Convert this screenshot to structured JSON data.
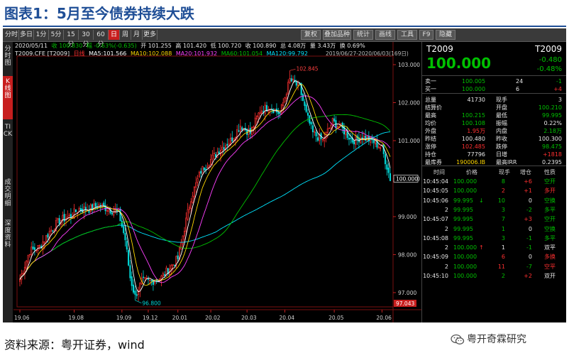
{
  "figure": {
    "title": "图表1：5月至今债券持续大跌",
    "source": "资料来源：粤开证券，wind",
    "watermark": "粤开奇霖研究"
  },
  "toolbar": {
    "left": [
      "分时",
      "多日",
      "1分",
      "5分",
      "15分",
      "30分",
      "60分",
      "日",
      "周",
      "月",
      "更多"
    ],
    "active": "日",
    "right": [
      "复权",
      "叠加品种",
      "统计",
      "画线",
      "工具",
      "F9",
      "隐藏"
    ]
  },
  "side_tabs": [
    "分时图",
    "K线图",
    "TICK",
    "成交明细",
    "深度资料"
  ],
  "side_tab_active": "K线图",
  "info": {
    "date": "2020/05/11",
    "close_lbl": "收 100.830",
    "chg_lbl": "幅 -0.63%(-0.635)",
    "open_lbl": "开 101.255",
    "high_lbl": "高 101.420",
    "low_lbl": "低 100.720",
    "lastclose_lbl": "收 100.890",
    "amount_lbl": "总 4.08万",
    "vol_lbl": "量 3.43万",
    "turn_lbl": "换 0.69%",
    "code_lbl": "T2009.CFE [T2009]",
    "period_lbl": "日线",
    "ma5": "MA5:101.566",
    "ma10": "MA10:102.088",
    "ma20": "MA20:101.932",
    "ma60": "MA60:101.054",
    "ma120": "MA120:99.792",
    "range": "2019/06/27-2020/06/03(169日)"
  },
  "chart_data": {
    "type": "candlestick",
    "title": "",
    "y_ticks": [
      "103.000",
      "102.000",
      "101.000",
      "100.000",
      "99.000",
      "98.000",
      "97.000"
    ],
    "ylim": [
      96.7,
      103.15
    ],
    "x_ticks": [
      "19.06",
      "19.08",
      "19.09",
      "19.12",
      "20.01",
      "20.02",
      "20.03",
      "20.04",
      "20.05",
      "20.06"
    ],
    "x_tick_index": [
      0,
      33,
      62,
      78,
      96,
      116,
      138,
      161,
      191,
      220
    ],
    "n": 226,
    "annotations": {
      "high": "102.845",
      "low": "96.800"
    },
    "current_price": "100.000",
    "bottom_price": "97.043",
    "ma_colors": {
      "MA5": "#ffffff",
      "MA10": "#ffd700",
      "MA20": "#ff40ff",
      "MA60": "#00c000",
      "MA120": "#00e5ff"
    },
    "anchors": [
      [
        0,
        97.35
      ],
      [
        6,
        98.1
      ],
      [
        12,
        98.2
      ],
      [
        18,
        98.6
      ],
      [
        24,
        98.9
      ],
      [
        30,
        99.0
      ],
      [
        36,
        99.2
      ],
      [
        42,
        99.2
      ],
      [
        48,
        99.3
      ],
      [
        54,
        99.2
      ],
      [
        60,
        99.1
      ],
      [
        64,
        98.4
      ],
      [
        67,
        97.4
      ],
      [
        70,
        96.9
      ],
      [
        74,
        97.3
      ],
      [
        80,
        97.3
      ],
      [
        86,
        97.4
      ],
      [
        92,
        97.7
      ],
      [
        96,
        97.9
      ],
      [
        100,
        98.7
      ],
      [
        104,
        99.5
      ],
      [
        110,
        100.2
      ],
      [
        116,
        100.5
      ],
      [
        122,
        100.8
      ],
      [
        128,
        101.0
      ],
      [
        134,
        101.4
      ],
      [
        140,
        101.2
      ],
      [
        146,
        101.8
      ],
      [
        152,
        101.9
      ],
      [
        158,
        101.7
      ],
      [
        164,
        102.6
      ],
      [
        170,
        102.4
      ],
      [
        174,
        101.7
      ],
      [
        178,
        101.2
      ],
      [
        184,
        101.0
      ],
      [
        190,
        101.5
      ],
      [
        196,
        101.3
      ],
      [
        202,
        101.0
      ],
      [
        208,
        101.1
      ],
      [
        214,
        101.0
      ],
      [
        220,
        100.8
      ],
      [
        225,
        100.0
      ]
    ]
  },
  "quote": {
    "code_left": "T2009",
    "code_right": "T2009",
    "price": "100.000",
    "chg": "-0.480",
    "chg_pct": "-0.48%",
    "book": [
      {
        "label": "卖一",
        "price": "100.005",
        "vol": "24",
        "chg": "-1",
        "chg_color": "g"
      },
      {
        "label": "买一",
        "price": "100.000",
        "vol": "6",
        "chg": "+4",
        "chg_color": "rd"
      }
    ],
    "stats": [
      {
        "l": "总量",
        "lv": "41730",
        "r": "现手",
        "rv": "3",
        "lc": "w",
        "rc": "w"
      },
      {
        "l": "结算价",
        "lv": "",
        "r": "开盘",
        "rv": "100.210",
        "lc": "w",
        "rc": "g"
      },
      {
        "l": "最高",
        "lv": "100.215",
        "r": "最低",
        "rv": "99.995",
        "lc": "g",
        "rc": "g"
      },
      {
        "l": "均价",
        "lv": "100.108",
        "r": "振幅",
        "rv": "0.22%",
        "lc": "g",
        "rc": "w"
      },
      {
        "l": "外盘",
        "lv": "1.95万",
        "r": "内盘",
        "rv": "2.18万",
        "lc": "rd",
        "rc": "g"
      },
      {
        "l": "昨结",
        "lv": "100.480",
        "r": "昨收",
        "rv": "100.300",
        "lc": "w",
        "rc": "w"
      },
      {
        "l": "涨停",
        "lv": "102.485",
        "r": "跌停",
        "rv": "98.475",
        "lc": "rd",
        "rc": "g"
      },
      {
        "l": "持仓",
        "lv": "77796",
        "r": "日增",
        "rv": "+1818",
        "lc": "w",
        "rc": "rd"
      },
      {
        "l": "最库券",
        "lv": "190006.IB",
        "r": "最高IRR",
        "rv": "0.2395",
        "lc": "y",
        "rc": "w"
      }
    ],
    "trades_header": [
      "时间",
      "价格",
      "现手",
      "增仓",
      "性质"
    ],
    "trades": [
      {
        "t": "10:45:04",
        "p": "100.000",
        "v": "8",
        "d": "+6",
        "n": "空开",
        "pc": "g",
        "vc": "g",
        "dc": "rd",
        "nc": "g"
      },
      {
        "t": "10:45:05",
        "p": "100.000",
        "v": "2",
        "d": "+1",
        "n": "多开",
        "pc": "g",
        "vc": "rd",
        "dc": "rd",
        "nc": "rd"
      },
      {
        "t": "10:45:06",
        "p": "99.995",
        "v": "10",
        "d": "0",
        "n": "空换",
        "pc": "g",
        "vc": "g",
        "dc": "w",
        "nc": "g",
        "arrow": "↓"
      },
      {
        "t": "2",
        "p": "99.995",
        "v": "3",
        "d": "-2",
        "n": "多平",
        "pc": "g",
        "vc": "g",
        "dc": "g",
        "nc": "g"
      },
      {
        "t": "10:45:07",
        "p": "99.995",
        "v": "7",
        "d": "+3",
        "n": "空开",
        "pc": "g",
        "vc": "g",
        "dc": "rd",
        "nc": "g"
      },
      {
        "t": "2",
        "p": "99.995",
        "v": "1",
        "d": "0",
        "n": "空换",
        "pc": "g",
        "vc": "g",
        "dc": "w",
        "nc": "g"
      },
      {
        "t": "10:45:08",
        "p": "99.995",
        "v": "3",
        "d": "-1",
        "n": "多平",
        "pc": "g",
        "vc": "g",
        "dc": "g",
        "nc": "g"
      },
      {
        "t": "2",
        "p": "100.000",
        "v": "1",
        "d": "-1",
        "n": "双平",
        "pc": "g",
        "vc": "w",
        "dc": "g",
        "nc": "w",
        "arrow": "↑"
      },
      {
        "t": "10:45:09",
        "p": "100.000",
        "v": "6",
        "d": "0",
        "n": "多换",
        "pc": "g",
        "vc": "rd",
        "dc": "w",
        "nc": "rd"
      },
      {
        "t": "2",
        "p": "100.000",
        "v": "11",
        "d": "-7",
        "n": "空平",
        "pc": "g",
        "vc": "rd",
        "dc": "g",
        "nc": "rd"
      },
      {
        "t": "10:45:10",
        "p": "100.000",
        "v": "2",
        "d": "+2",
        "n": "双开",
        "pc": "g",
        "vc": "g",
        "dc": "rd",
        "nc": "w"
      }
    ]
  }
}
